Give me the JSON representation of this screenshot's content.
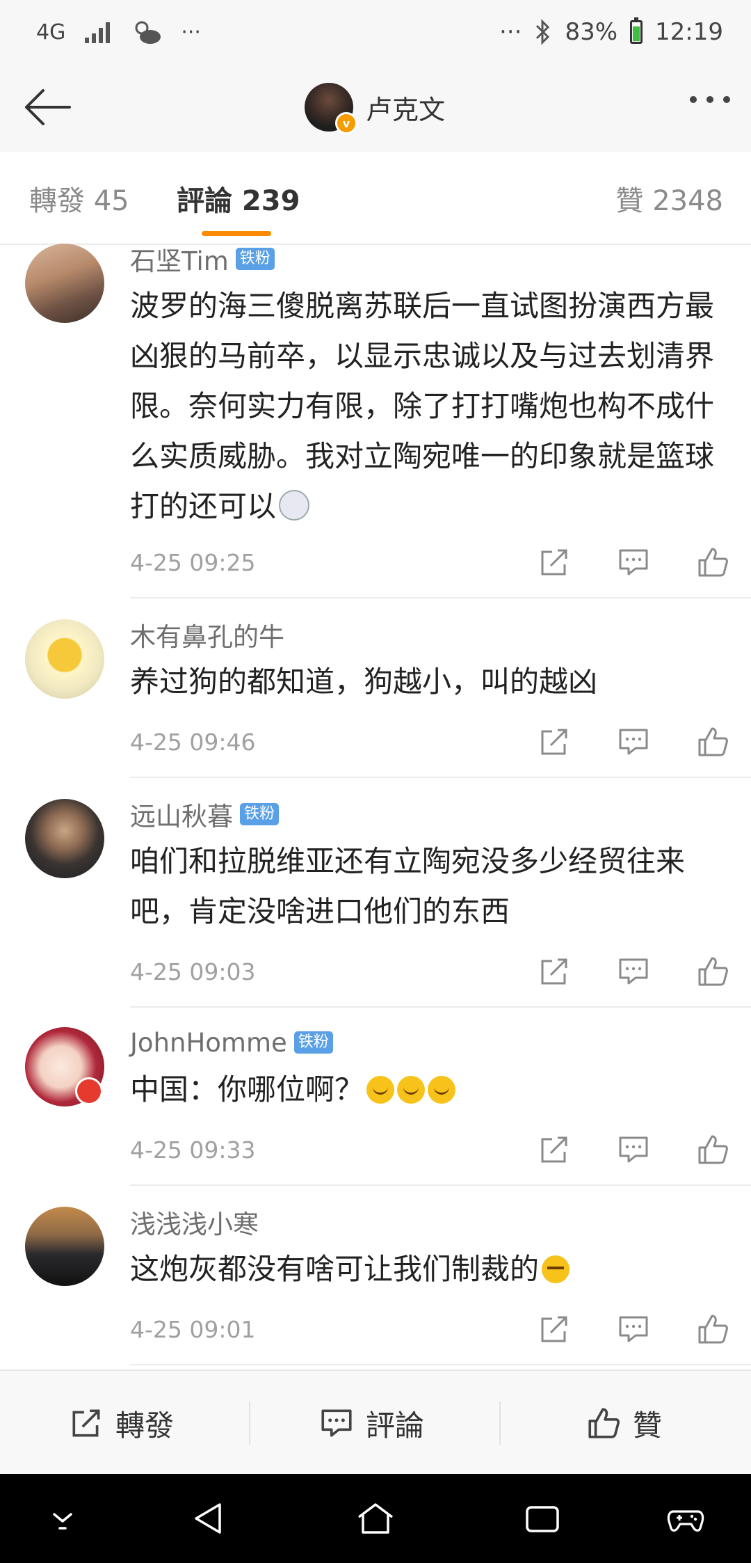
{
  "status_bar": {
    "network": "4G",
    "signal_icon": "signal-icon",
    "weather_icon": "weather-cloud-sun-icon",
    "more_left": "···",
    "more_right": "···",
    "bluetooth_icon": "bluetooth-icon",
    "battery": "83%",
    "time": "12:19"
  },
  "header": {
    "title": "卢克文",
    "back_icon": "back-arrow-icon",
    "more_icon": "more-dots-icon"
  },
  "tabs": [
    {
      "label": "轉發 45"
    },
    {
      "label": "評論 239",
      "active": true
    },
    {
      "label": "贊 2348"
    }
  ],
  "comments": [
    {
      "user": "石坚Tim",
      "badge": "铁粉",
      "text": "波罗的海三傻脱离苏联后一直试图扮演西方最凶狠的马前卒，以显示忠诚以及与过去划清界限。奈何实力有限，除了打打嘴炮也构不成什么实质威胁。我对立陶宛唯一的印象就是篮球打的还可以",
      "emoji": "dog",
      "time": "4-25 09:25"
    },
    {
      "user": "木有鼻孔的牛",
      "badge": "",
      "text": "养过狗的都知道，狗越小，叫的越凶",
      "emoji": "",
      "time": "4-25 09:46"
    },
    {
      "user": "远山秋暮",
      "badge": "铁粉",
      "text": "咱们和拉脱维亚还有立陶宛没多少经贸往来吧，肯定没啥进口他们的东西",
      "emoji": "",
      "time": "4-25 09:03"
    },
    {
      "user": "JohnHomme",
      "badge": "铁粉",
      "text": "中国：你哪位啊？",
      "emoji": "cry",
      "time": "4-25 09:33"
    },
    {
      "user": "浅浅浅小寒",
      "badge": "",
      "text": "这炮灰都没有啥可让我们制裁的",
      "emoji": "smirk",
      "time": "4-25 09:01"
    }
  ],
  "bottom_bar": {
    "repost_label": "轉發",
    "comment_label": "評論",
    "like_label": "贊"
  },
  "colors": {
    "accent": "#fb8a00",
    "badge": "#5aa0e6",
    "muted": "#a0a0a0"
  }
}
